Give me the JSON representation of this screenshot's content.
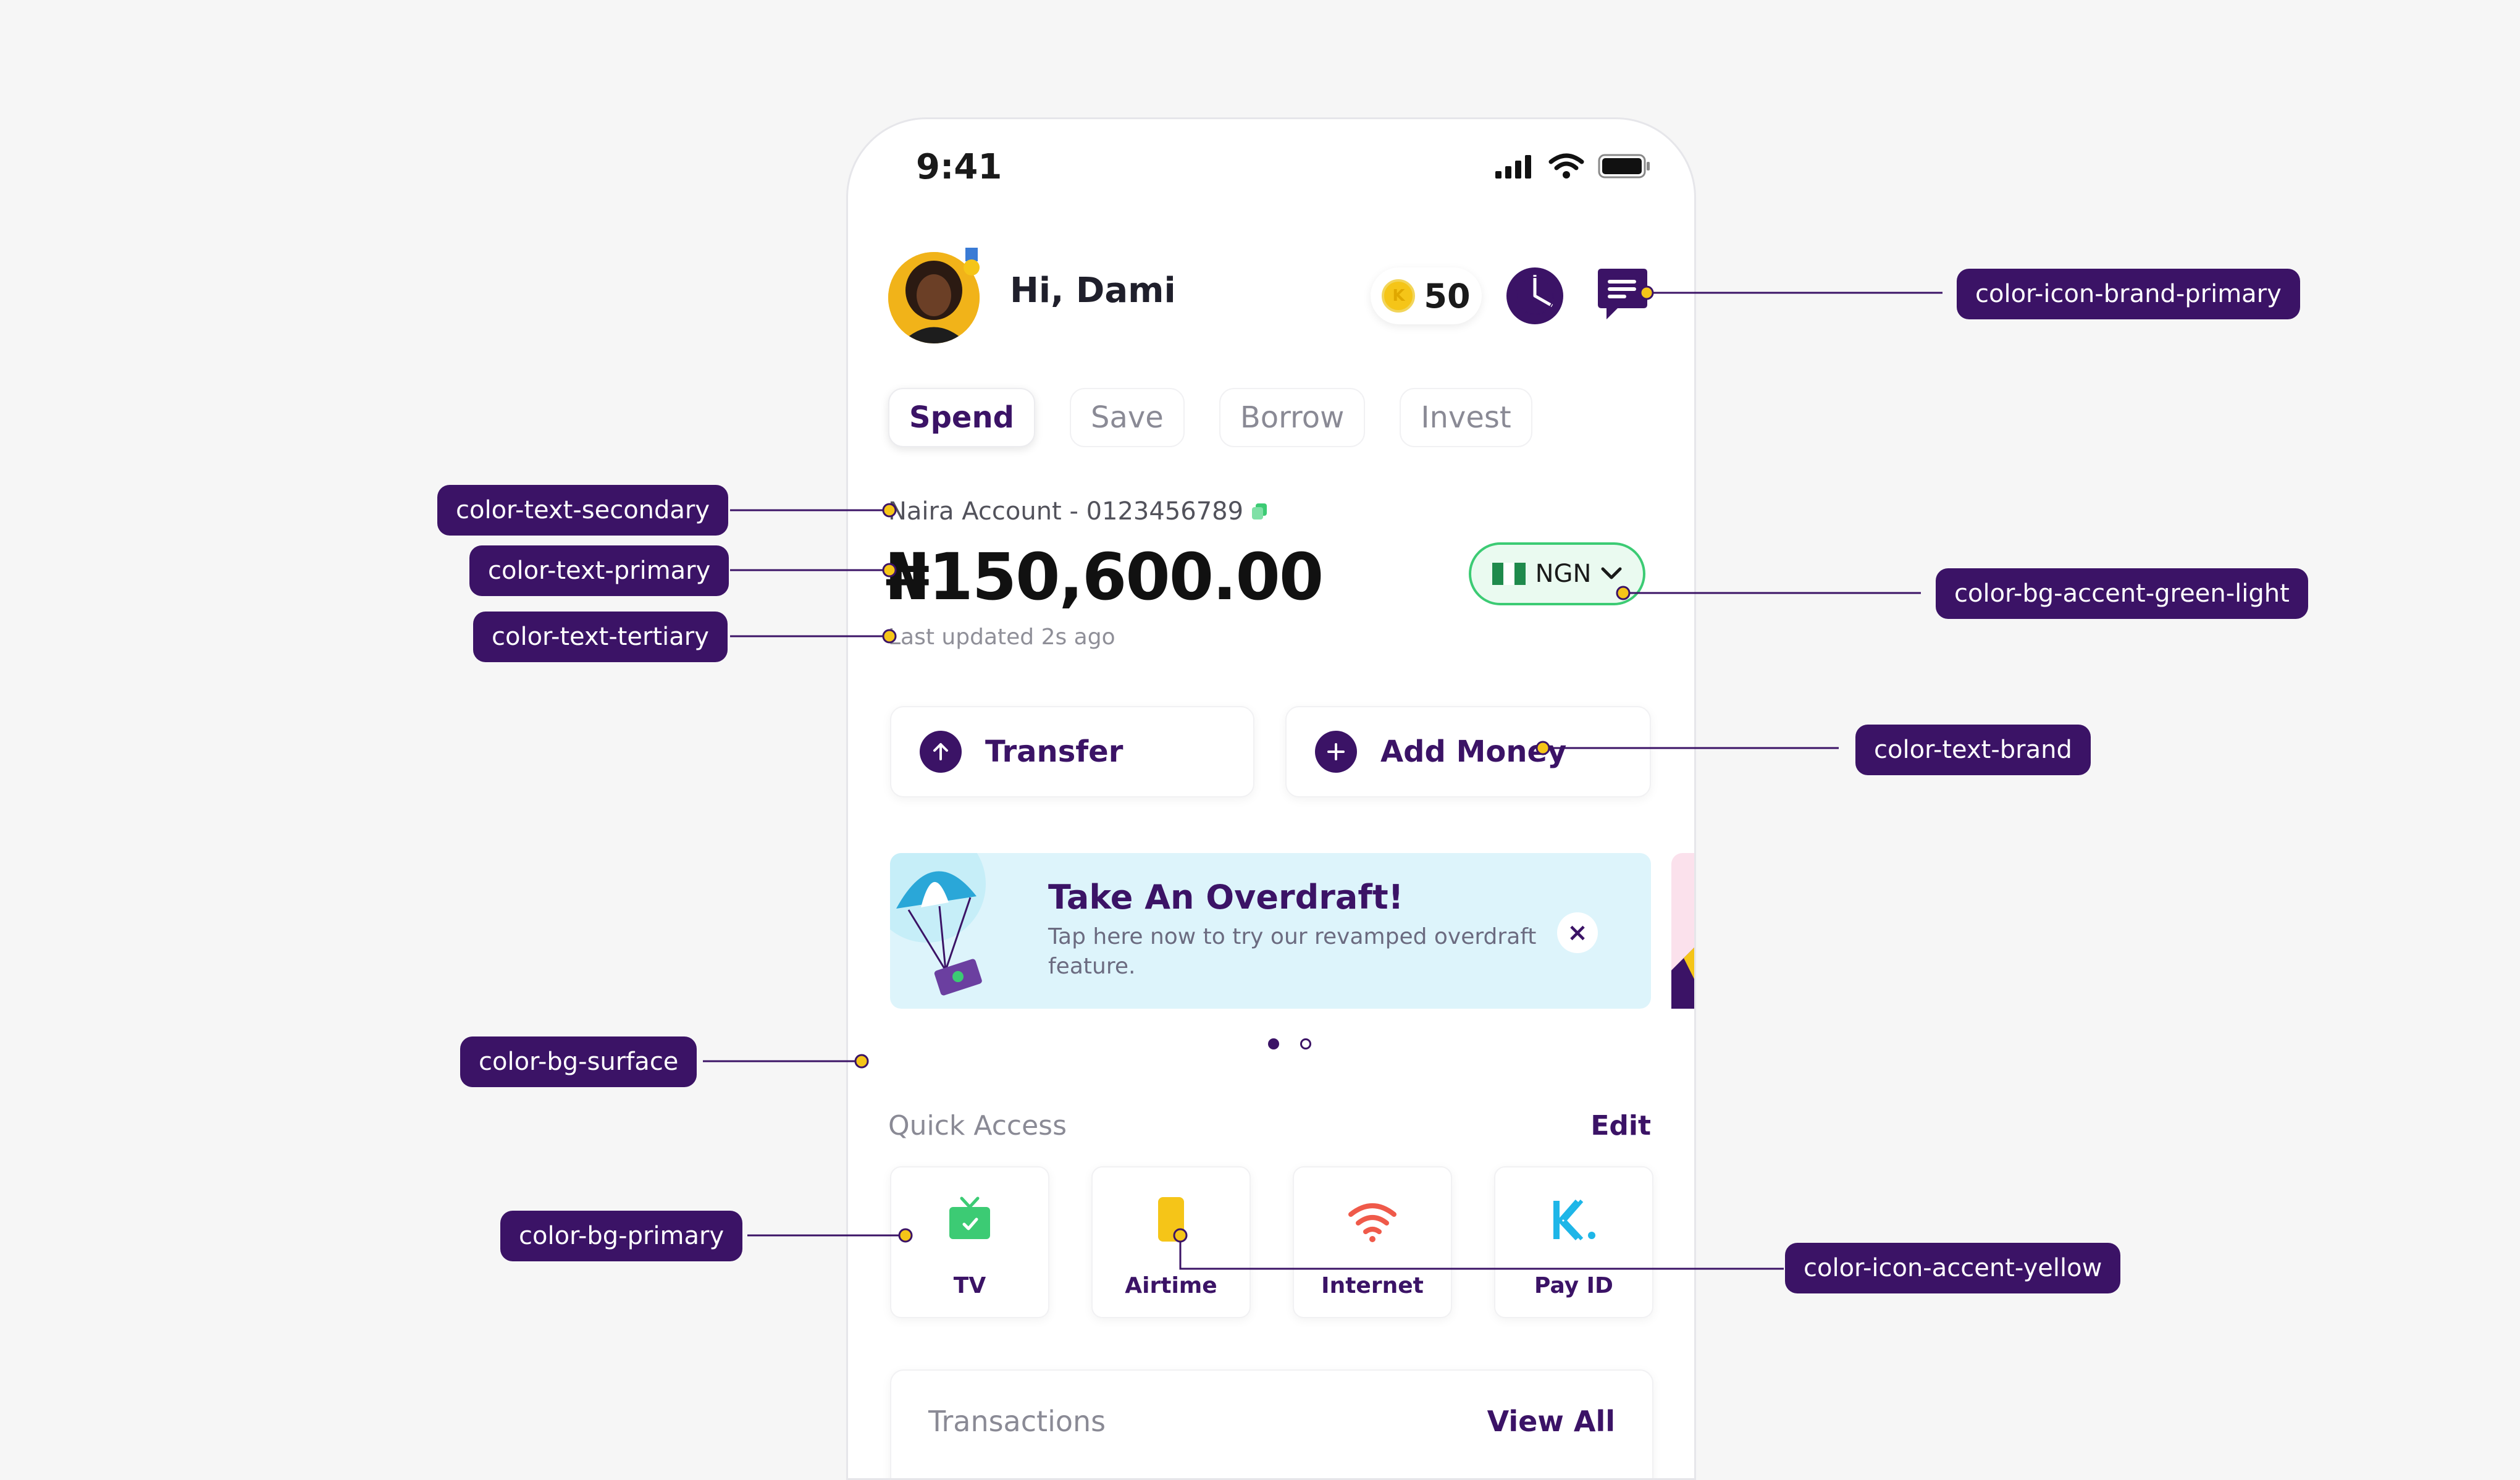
{
  "status": {
    "time": "9:41"
  },
  "header": {
    "greeting": "Hi, Dami",
    "points": "50"
  },
  "tabs": [
    {
      "label": "Spend",
      "active": true
    },
    {
      "label": "Save",
      "active": false
    },
    {
      "label": "Borrow",
      "active": false
    },
    {
      "label": "Invest",
      "active": false
    }
  ],
  "account": {
    "line": "Naira Account - 0123456789",
    "balance": "₦150,600.00",
    "updated": "Last updated 2s ago",
    "currency": "NGN"
  },
  "actions": {
    "transfer": "Transfer",
    "add_money": "Add Money"
  },
  "banner": {
    "title": "Take An Overdraft!",
    "desc": "Tap here now to try our revamped overdraft feature.",
    "close": "×"
  },
  "quick_access": {
    "title": "Quick Access",
    "edit": "Edit",
    "items": [
      {
        "label": "TV",
        "icon": "tv-icon"
      },
      {
        "label": "Airtime",
        "icon": "phone-icon"
      },
      {
        "label": "Internet",
        "icon": "wifi-icon"
      },
      {
        "label": "Pay ID",
        "icon": "kuda-k-icon"
      }
    ]
  },
  "transactions": {
    "title": "Transactions",
    "view_all": "View All"
  },
  "annotations": {
    "icon_brand_primary": "color-icon-brand-primary",
    "text_secondary": "color-text-secondary",
    "text_primary": "color-text-primary",
    "text_tertiary": "color-text-tertiary",
    "bg_accent_green_light": "color-bg-accent-green-light",
    "text_brand": "color-text-brand",
    "bg_surface": "color-bg-surface",
    "bg_primary": "color-bg-primary",
    "icon_accent_yellow": "color-icon-accent-yellow"
  },
  "colors": {
    "brand": "#3b1366",
    "accent_green": "#3ccb74",
    "accent_yellow": "#f5c518",
    "banner_bg": "#ddf4fb",
    "tv_green": "#3ccb74",
    "wifi_red": "#ef5a4a",
    "payid_blue": "#1eb6e8"
  }
}
